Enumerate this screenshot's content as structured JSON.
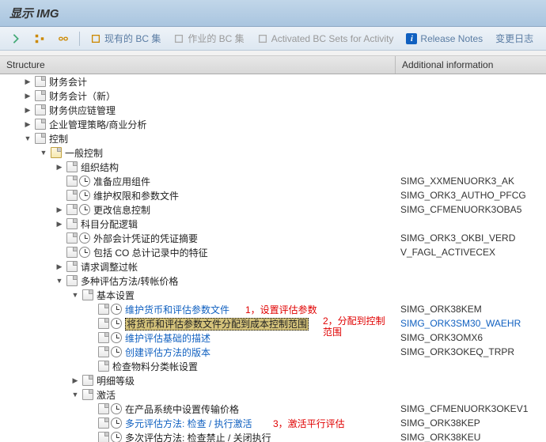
{
  "title": "显示 IMG",
  "toolbar": {
    "existing_bc": "现有的 BC 集",
    "job_bc": "作业的 BC 集",
    "activated_bc": "Activated BC Sets for Activity",
    "release_notes": "Release Notes",
    "change_log": "变更日志"
  },
  "headers": {
    "structure": "Structure",
    "info": "Additional information"
  },
  "tree": [
    {
      "indent": 1,
      "toggle": "▶",
      "docs": [
        "d"
      ],
      "text": "财务会计"
    },
    {
      "indent": 1,
      "toggle": "▶",
      "docs": [
        "d"
      ],
      "text": "财务会计（新）"
    },
    {
      "indent": 1,
      "toggle": "▶",
      "docs": [
        "d"
      ],
      "text": "财务供应链管理"
    },
    {
      "indent": 1,
      "toggle": "▶",
      "docs": [
        "d"
      ],
      "text": "企业管理策略/商业分析"
    },
    {
      "indent": 1,
      "toggle": "▼",
      "docs": [
        "d"
      ],
      "text": "控制"
    },
    {
      "indent": 2,
      "toggle": "▼",
      "docs": [
        "df"
      ],
      "text": "一般控制"
    },
    {
      "indent": 3,
      "toggle": "▶",
      "docs": [
        "d"
      ],
      "text": "组织结构"
    },
    {
      "indent": 3,
      "toggle": "",
      "docs": [
        "d",
        "c"
      ],
      "text": "准备应用组件",
      "right": "SIMG_XXMENUORK3_AK"
    },
    {
      "indent": 3,
      "toggle": "",
      "docs": [
        "d",
        "c"
      ],
      "text": "维护权限和参数文件",
      "right": "SIMG_ORK3_AUTHO_PFCG"
    },
    {
      "indent": 3,
      "toggle": "▶",
      "docs": [
        "d",
        "c"
      ],
      "text": "更改信息控制",
      "right": "SIMG_CFMENUORK3OBA5"
    },
    {
      "indent": 3,
      "toggle": "▶",
      "docs": [
        "d"
      ],
      "text": "科目分配逻辑"
    },
    {
      "indent": 3,
      "toggle": "",
      "docs": [
        "d",
        "c"
      ],
      "text": "外部会计凭证的凭证摘要",
      "right": "SIMG_ORK3_OKBI_VERD"
    },
    {
      "indent": 3,
      "toggle": "",
      "docs": [
        "d",
        "c"
      ],
      "text": "包括 CO 总计记录中的特征",
      "right": "V_FAGL_ACTIVECEX"
    },
    {
      "indent": 3,
      "toggle": "▶",
      "docs": [
        "d"
      ],
      "text": "请求调整过帐"
    },
    {
      "indent": 3,
      "toggle": "▼",
      "docs": [
        "d"
      ],
      "text": "多种评估方法/转帐价格"
    },
    {
      "indent": 4,
      "toggle": "▼",
      "docs": [
        "d"
      ],
      "text": "基本设置"
    },
    {
      "indent": 5,
      "toggle": "",
      "docs": [
        "d",
        "c"
      ],
      "text": "维护货币和评估参数文件",
      "link": true,
      "right": "SIMG_ORK38KEM"
    },
    {
      "indent": 5,
      "toggle": "",
      "docs": [
        "d",
        "c"
      ],
      "text": "将货币和评估参数文件分配到成本控制范围",
      "sel": true,
      "right": "SIMG_ORK3SM30_WAEHR",
      "rightblue": true
    },
    {
      "indent": 5,
      "toggle": "",
      "docs": [
        "d",
        "c"
      ],
      "text": "维护评估基础的描述",
      "link": true,
      "right": "SIMG_ORK3OMX6"
    },
    {
      "indent": 5,
      "toggle": "",
      "docs": [
        "d",
        "c"
      ],
      "text": "创建评估方法的版本",
      "link": true,
      "right": "SIMG_ORK3OKEQ_TRPR"
    },
    {
      "indent": 5,
      "toggle": "",
      "docs": [
        "d"
      ],
      "text": "检查物料分类帐设置"
    },
    {
      "indent": 4,
      "toggle": "▶",
      "docs": [
        "d"
      ],
      "text": "明细等级"
    },
    {
      "indent": 4,
      "toggle": "▼",
      "docs": [
        "d"
      ],
      "text": "激活"
    },
    {
      "indent": 5,
      "toggle": "",
      "docs": [
        "d",
        "c"
      ],
      "text": "在产品系统中设置传输价格",
      "right": "SIMG_CFMENUORK3OKEV1"
    },
    {
      "indent": 5,
      "toggle": "",
      "docs": [
        "d",
        "c"
      ],
      "text": "多元评估方法: 检查 / 执行激活",
      "link": true,
      "right": "SIMG_ORK38KEP"
    },
    {
      "indent": 5,
      "toggle": "",
      "docs": [
        "d",
        "c"
      ],
      "text": "多次评估方法: 检查禁止 / 关闭执行",
      "right": "SIMG_ORK38KEU"
    }
  ],
  "annotations": {
    "a1": "1，设置评估参数",
    "a2": "2，分配到控制范围",
    "a3": "3，激活平行评估"
  }
}
